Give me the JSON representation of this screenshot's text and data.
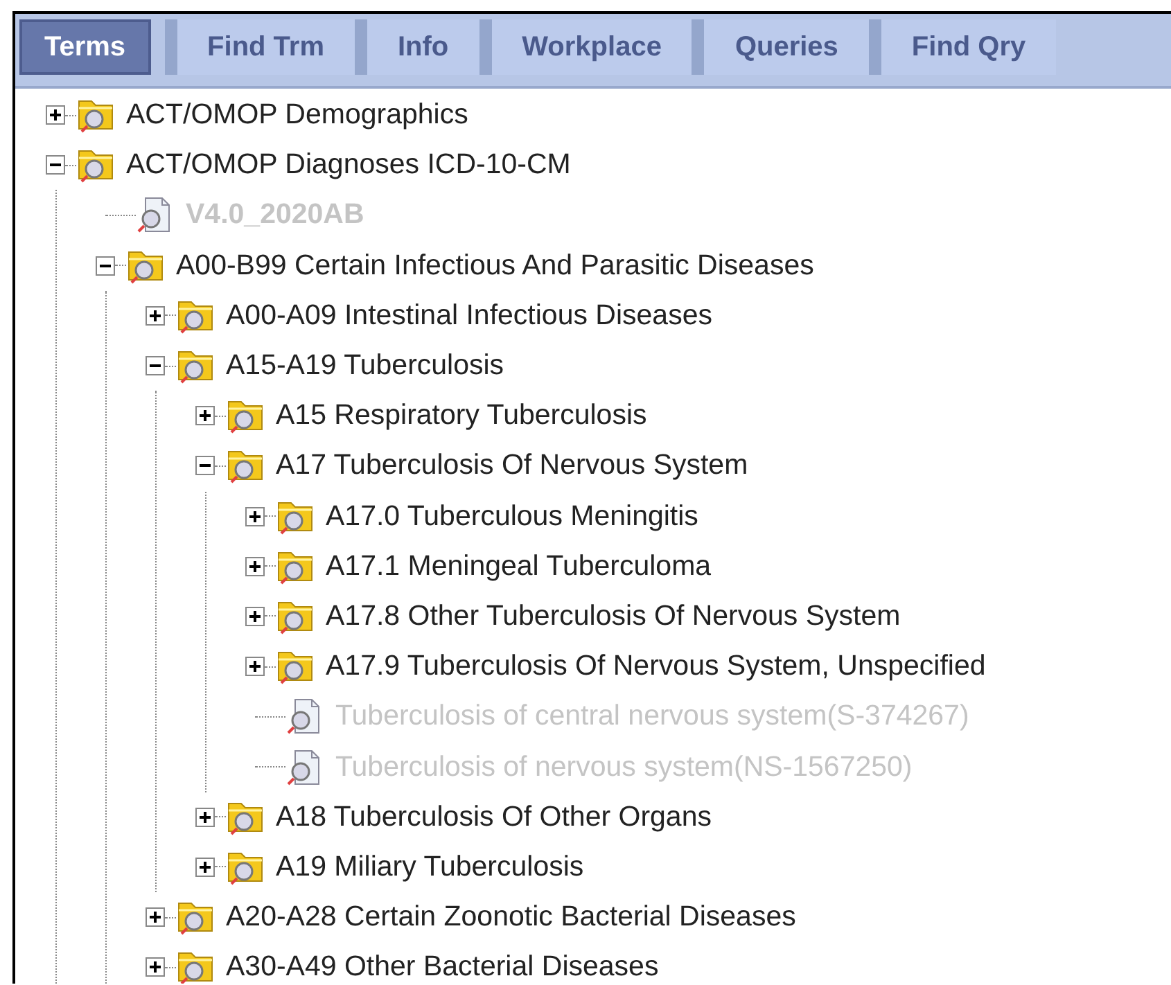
{
  "tabs": [
    {
      "label": "Terms",
      "selected": true
    },
    {
      "label": "Find Trm",
      "selected": false
    },
    {
      "label": "Info",
      "selected": false
    },
    {
      "label": "Workplace",
      "selected": false
    },
    {
      "label": "Queries",
      "selected": false
    },
    {
      "label": "Find Qry",
      "selected": false
    }
  ],
  "tree": [
    {
      "kind": "folder",
      "label": "ACT/OMOP Demographics",
      "expanded": false
    },
    {
      "kind": "folder",
      "label": "ACT/OMOP Diagnoses ICD-10-CM",
      "expanded": true,
      "children": [
        {
          "kind": "version",
          "label": "V4.0_2020AB"
        },
        {
          "kind": "folder",
          "label": "A00-B99 Certain Infectious And Parasitic Diseases",
          "expanded": true,
          "children": [
            {
              "kind": "folder",
              "label": "A00-A09 Intestinal Infectious Diseases",
              "expanded": false
            },
            {
              "kind": "folder",
              "label": "A15-A19 Tuberculosis",
              "expanded": true,
              "children": [
                {
                  "kind": "folder",
                  "label": "A15 Respiratory Tuberculosis",
                  "expanded": false
                },
                {
                  "kind": "folder",
                  "label": "A17 Tuberculosis Of Nervous System",
                  "expanded": true,
                  "children": [
                    {
                      "kind": "folder",
                      "label": "A17.0 Tuberculous Meningitis",
                      "expanded": false
                    },
                    {
                      "kind": "folder",
                      "label": "A17.1 Meningeal Tuberculoma",
                      "expanded": false
                    },
                    {
                      "kind": "folder",
                      "label": "A17.8 Other Tuberculosis Of Nervous System",
                      "expanded": false
                    },
                    {
                      "kind": "folder",
                      "label": "A17.9 Tuberculosis Of Nervous System, Unspecified",
                      "expanded": false
                    },
                    {
                      "kind": "leaf",
                      "label": "Tuberculosis of central nervous system(S-374267)"
                    },
                    {
                      "kind": "leaf",
                      "label": "Tuberculosis of nervous system(NS-1567250)"
                    }
                  ]
                },
                {
                  "kind": "folder",
                  "label": "A18 Tuberculosis Of Other Organs",
                  "expanded": false
                },
                {
                  "kind": "folder",
                  "label": "A19 Miliary Tuberculosis",
                  "expanded": false
                }
              ]
            },
            {
              "kind": "folder",
              "label": "A20-A28 Certain Zoonotic Bacterial Diseases",
              "expanded": false
            },
            {
              "kind": "folder",
              "label": "A30-A49 Other Bacterial Diseases",
              "expanded": false
            }
          ]
        }
      ]
    }
  ]
}
